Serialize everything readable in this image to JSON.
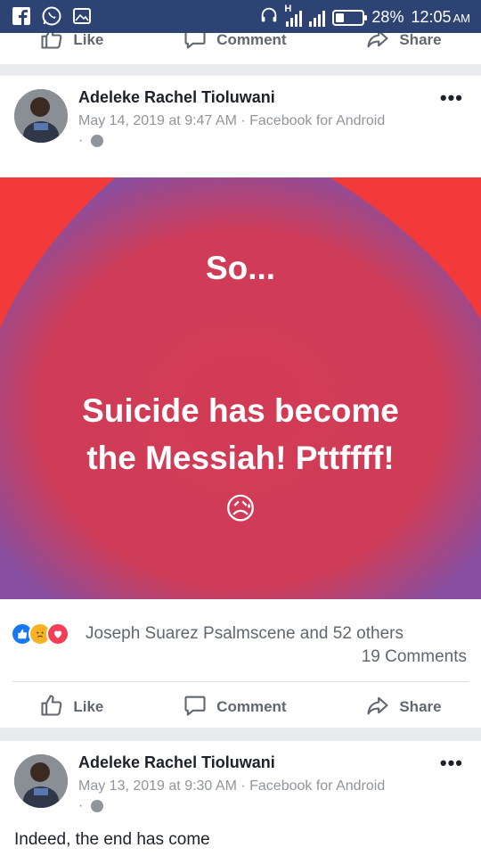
{
  "status_bar": {
    "network_mark": "H",
    "battery": "28%",
    "time": "12:05",
    "ampm": "AM"
  },
  "top_actions": {
    "like": "Like",
    "comment": "Comment",
    "share": "Share"
  },
  "post1": {
    "author": "Adeleke Rachel Tioluwani",
    "meta_date": "May 14, 2019 at 9:47 AM",
    "meta_sep": "·",
    "meta_source": "Facebook for Android",
    "meta_dot": "·",
    "poster_line1": "So...",
    "poster_line2": "Suicide has become",
    "poster_line3": "the Messiah! Pttffff!",
    "poster_emoji": "😥",
    "reactions_text": "Joseph Suarez Psalmscene and 52 others",
    "comments_count": "19 Comments",
    "actions": {
      "like": "Like",
      "comment": "Comment",
      "share": "Share"
    },
    "colors": {
      "poster_red": "#f23a3a",
      "blob_purple": "#8a4fa0",
      "blob_center": "#d23b55"
    }
  },
  "post2": {
    "author": "Adeleke Rachel Tioluwani",
    "meta_date": "May 13, 2019 at 9:30 AM",
    "meta_sep": "·",
    "meta_source": "Facebook for Android",
    "meta_dot": "·",
    "text": "Indeed, the end has come"
  }
}
